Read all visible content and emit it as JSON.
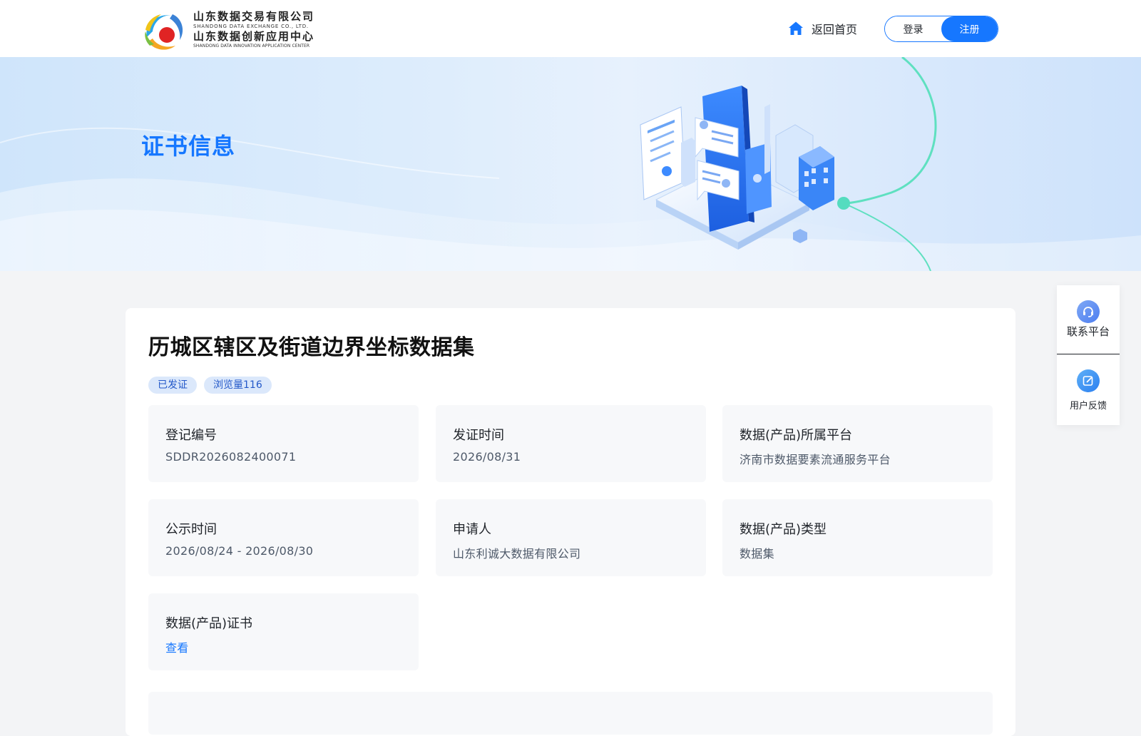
{
  "header": {
    "logo": {
      "name_cn_1": "山东数据交易有限公司",
      "name_en_1": "SHANDONG DATA EXCHANGE CO., LTD.",
      "name_cn_2": "山东数据创新应用中心",
      "name_en_2": "SHANDONG DATA INNOVATION APPLICATION CENTER"
    },
    "home_label": "返回首页",
    "login_label": "登录",
    "register_label": "注册"
  },
  "banner": {
    "title": "证书信息"
  },
  "dataset": {
    "title": "历城区辖区及街道边界坐标数据集",
    "tags": [
      "已发证",
      "浏览量116"
    ],
    "fields": [
      {
        "label": "登记编号",
        "value": "SDDR2026082400071"
      },
      {
        "label": "发证时间",
        "value": "2026/08/31"
      },
      {
        "label": "数据(产品)所属平台",
        "value": "济南市数据要素流通服务平台"
      },
      {
        "label": "公示时间",
        "value": "2026/08/24 - 2026/08/30"
      },
      {
        "label": "申请人",
        "value": "山东利诚大数据有限公司"
      },
      {
        "label": "数据(产品)类型",
        "value": "数据集"
      },
      {
        "label": "数据(产品)证书",
        "value": "查看"
      }
    ]
  },
  "side_panel": {
    "contact_label": "联系平台",
    "feedback_label": "用户反馈"
  },
  "colors": {
    "accent": "#1677ff",
    "tag_bg": "#dbe8fb",
    "card_bg": "#f7f8fa"
  }
}
